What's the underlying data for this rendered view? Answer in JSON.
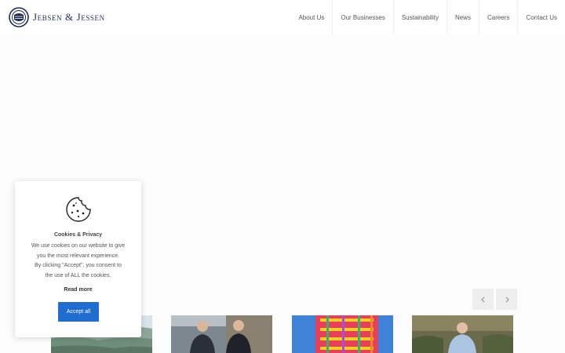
{
  "header": {
    "logo_text": "Jebsen & Jessen",
    "logo_icon": "crest-emblem-icon",
    "nav": [
      {
        "label": "About Us"
      },
      {
        "label": "Our Businesses"
      },
      {
        "label": "Sustainability"
      },
      {
        "label": "News"
      },
      {
        "label": "Careers"
      },
      {
        "label": "Contact Us"
      }
    ]
  },
  "carousel": {
    "prev_icon": "chevron-left-icon",
    "next_icon": "chevron-right-icon",
    "cards": [
      {
        "image": "landscape-photo"
      },
      {
        "image": "two-men-photo"
      },
      {
        "image": "colorful-scaffold-photo"
      },
      {
        "image": "man-in-forest-photo"
      }
    ]
  },
  "cookie_banner": {
    "icon": "cookie-icon",
    "title": "Cookies & Privacy",
    "text_lines": [
      "We use cookies on our website to give",
      "you the most relevant experience.",
      "By clicking \"Accept\", you consent to",
      "the use of ALL the cookies."
    ],
    "read_more": "Read more",
    "accept_label": "Accept all"
  },
  "colors": {
    "brand_navy": "#1f2d55",
    "accept_button": "#1f6dd1",
    "page_bg": "#fcfcfc"
  }
}
